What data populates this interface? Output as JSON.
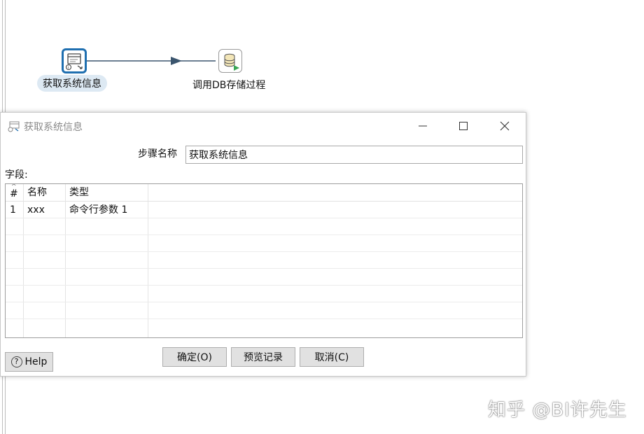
{
  "canvas": {
    "steps": [
      {
        "label": "获取系统信息",
        "icon": "system-info-icon",
        "selected": true
      },
      {
        "label": "调用DB存储过程",
        "icon": "db-procedure-icon",
        "selected": false
      }
    ]
  },
  "dialog": {
    "title": "获取系统信息",
    "title_icon": "system-info-icon",
    "step_name_label": "步骤名称",
    "step_name_value": "获取系统信息",
    "fields_label": "字段:",
    "table": {
      "columns": [
        "#",
        "名称",
        "类型",
        ""
      ],
      "rows": [
        [
          "1",
          "xxx",
          "命令行参数 1",
          ""
        ]
      ]
    },
    "buttons": {
      "help": "Help",
      "ok": "确定(O)",
      "preview": "预览记录",
      "cancel": "取消(C)"
    }
  },
  "watermark": "知乎 @BI许先生",
  "colors": {
    "accent": "#1f6fb0",
    "hop_arrow": "#3b556e",
    "selection_bg": "#dde9f3",
    "button_bg": "#e1e1e1"
  }
}
